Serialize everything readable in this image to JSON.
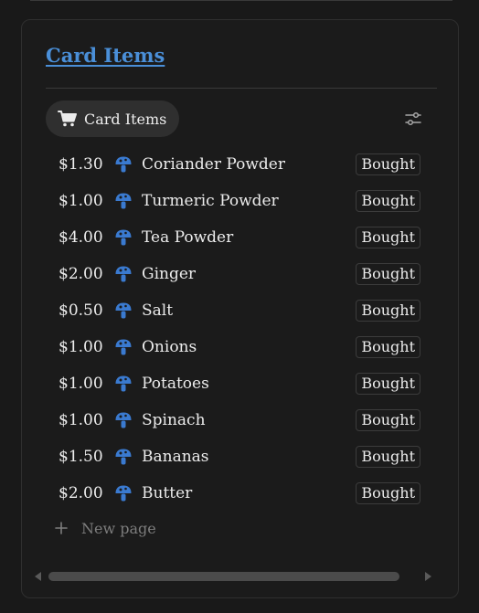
{
  "database": {
    "title": "Card Items",
    "view_tab_label": "Card Items",
    "icons": {
      "view_tab": "cart-icon",
      "filter": "sliders-icon",
      "row": "mushroom-icon",
      "new_page": "plus-icon"
    },
    "colors": {
      "title": "#4a8fd8",
      "row_icon": "#3a7ad0",
      "background": "#191919",
      "tab_background": "#2f2f2f"
    },
    "items": [
      {
        "price": "$1.30",
        "name": "Coriander Powder",
        "status": "Bought"
      },
      {
        "price": "$1.00",
        "name": "Turmeric Powder",
        "status": "Bought"
      },
      {
        "price": "$4.00",
        "name": "Tea Powder",
        "status": "Bought"
      },
      {
        "price": "$2.00",
        "name": "Ginger",
        "status": "Bought"
      },
      {
        "price": "$0.50",
        "name": "Salt",
        "status": "Bought"
      },
      {
        "price": "$1.00",
        "name": "Onions",
        "status": "Bought"
      },
      {
        "price": "$1.00",
        "name": "Potatoes",
        "status": "Bought"
      },
      {
        "price": "$1.00",
        "name": "Spinach",
        "status": "Bought"
      },
      {
        "price": "$1.50",
        "name": "Bananas",
        "status": "Bought"
      },
      {
        "price": "$2.00",
        "name": "Butter",
        "status": "Bought"
      }
    ],
    "new_page_label": "New page"
  }
}
